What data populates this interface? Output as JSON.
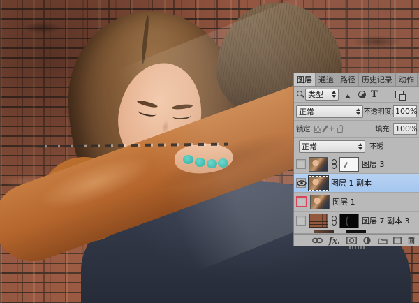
{
  "panel": {
    "tabs": [
      {
        "label": "图层"
      },
      {
        "label": "通道"
      },
      {
        "label": "路径"
      },
      {
        "label": "历史记录"
      },
      {
        "label": "动作"
      }
    ],
    "filter": {
      "kind_label": "类型",
      "icons": [
        "search-icon",
        "pixel-layer-filter-icon",
        "adjustment-layer-filter-icon",
        "type-layer-filter-icon",
        "shape-layer-filter-icon",
        "smart-object-filter-icon"
      ]
    },
    "blend": {
      "mode": "正常",
      "opacity_label": "不透明度:",
      "opacity_value": "100%"
    },
    "lock": {
      "label": "锁定:",
      "fill_label": "填充:",
      "fill_value": "100%"
    },
    "blend2": {
      "mode": "正常",
      "opacity_label_truncated": "不透"
    },
    "layers": [
      {
        "name": "图层 3"
      },
      {
        "name": "图层 1 副本"
      },
      {
        "name": "图层 1"
      },
      {
        "name": "图层 7 副本 3"
      }
    ],
    "bottom_icons": [
      "link-layers-icon",
      "layer-fx-icon",
      "add-layer-mask-icon",
      "new-adjustment-layer-icon",
      "new-group-icon",
      "new-layer-icon",
      "delete-layer-icon"
    ]
  },
  "colors": {
    "selected_layer": "#aecdf0",
    "highlight_red": "#d6455c",
    "nail_teal": "#2fb3a6",
    "jacket": "#b4652c",
    "shirt": "#2e3442",
    "brick": "#955640"
  }
}
